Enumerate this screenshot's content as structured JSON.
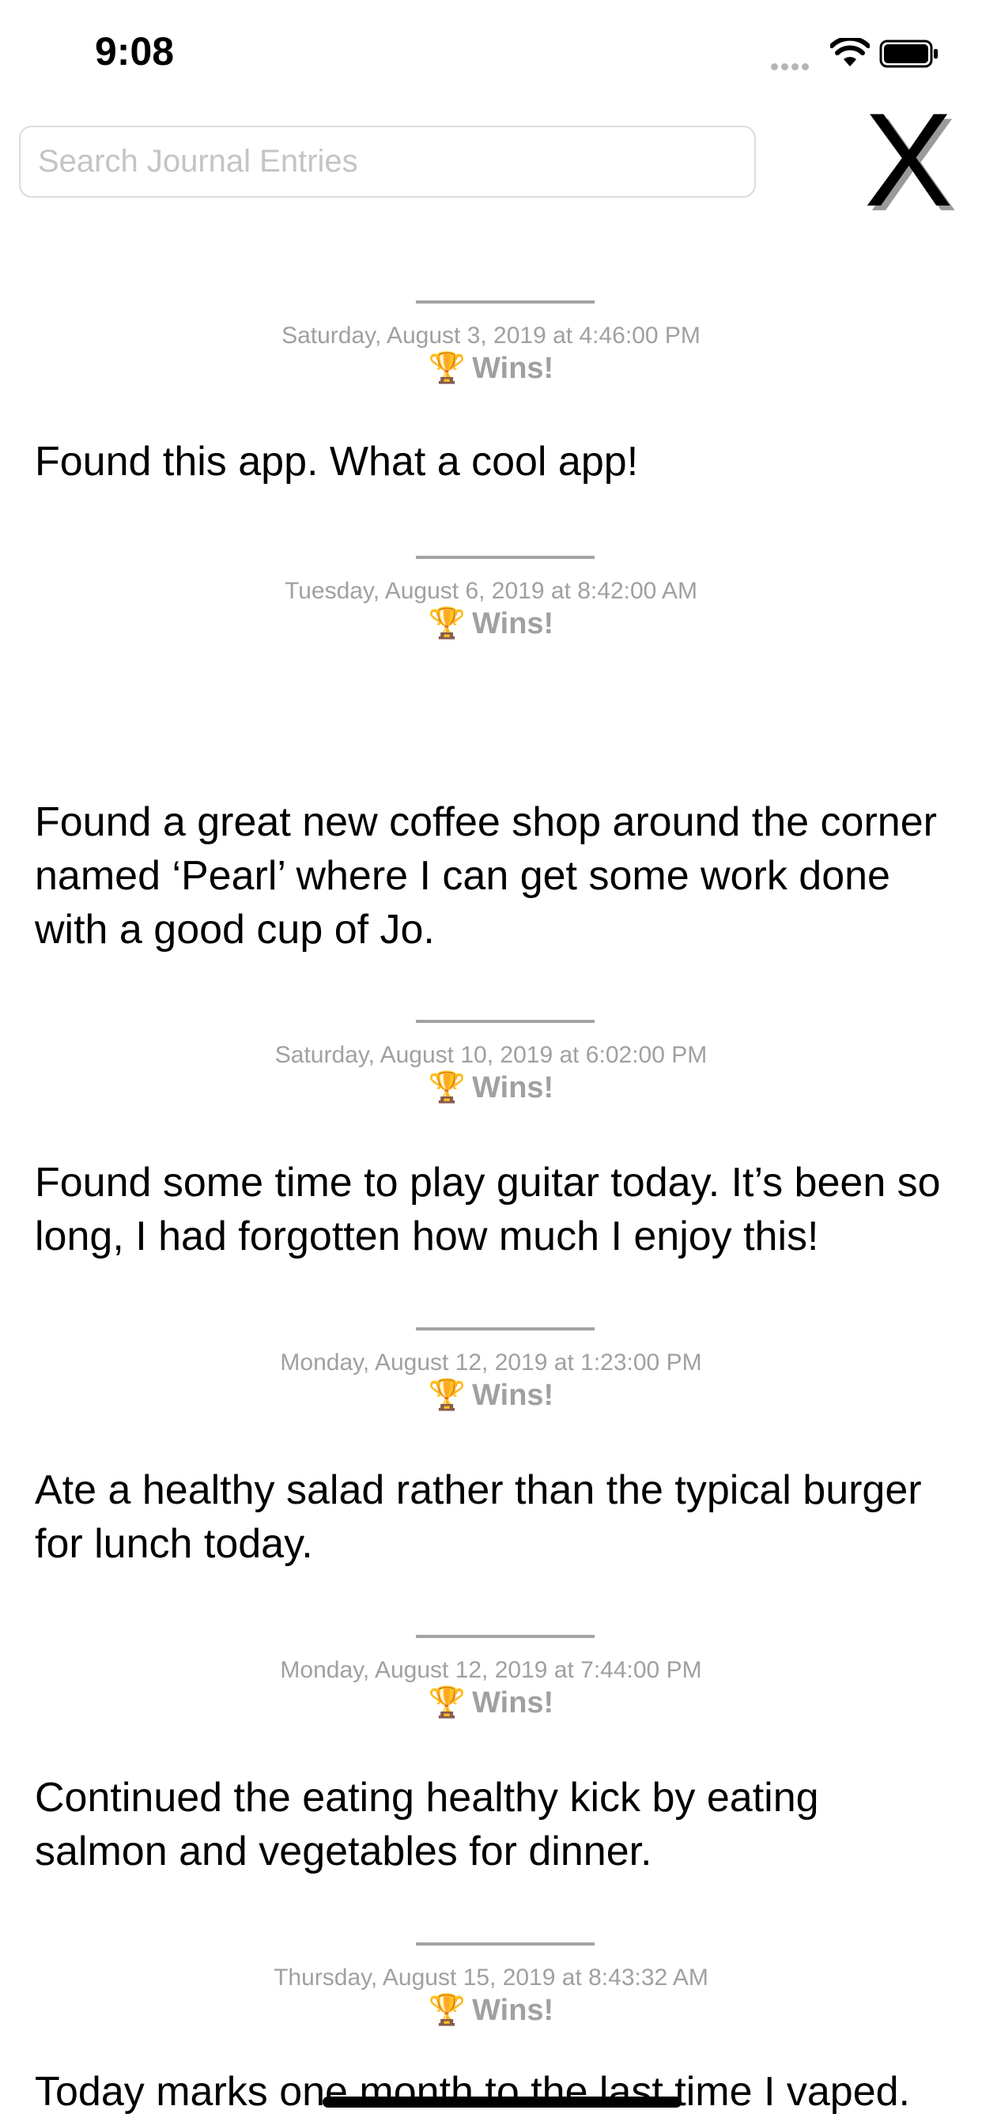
{
  "status_bar": {
    "time": "9:08"
  },
  "search": {
    "placeholder": "Search Journal Entries"
  },
  "close_button": {
    "label": "X"
  },
  "entries": [
    {
      "date": "Saturday, August 3, 2019 at 4:46:00 PM",
      "category": "Wins!",
      "text": "Found this app. What a cool app!"
    },
    {
      "date": "Tuesday, August 6, 2019 at 8:42:00 AM",
      "category": "Wins!",
      "text": "Found a great new coffee shop around the corner named ‘Pearl’ where I can get some work done with a good cup of Jo."
    },
    {
      "date": "Saturday, August 10, 2019 at 6:02:00 PM",
      "category": "Wins!",
      "text": "Found some time to play guitar today. It’s been so long, I had forgotten how much I enjoy this!"
    },
    {
      "date": "Monday, August 12, 2019 at 1:23:00 PM",
      "category": "Wins!",
      "text": "Ate a healthy salad rather than the typical burger for lunch today."
    },
    {
      "date": "Monday, August 12, 2019 at 7:44:00 PM",
      "category": "Wins!",
      "text": "Continued the eating healthy kick by eating salmon and vegetables for dinner."
    },
    {
      "date": "Thursday, August 15, 2019 at 8:43:32 AM",
      "category": "Wins!",
      "text": "Today marks one month to the last time I vaped."
    }
  ],
  "icons": {
    "entry_category": "trophy-icon"
  }
}
